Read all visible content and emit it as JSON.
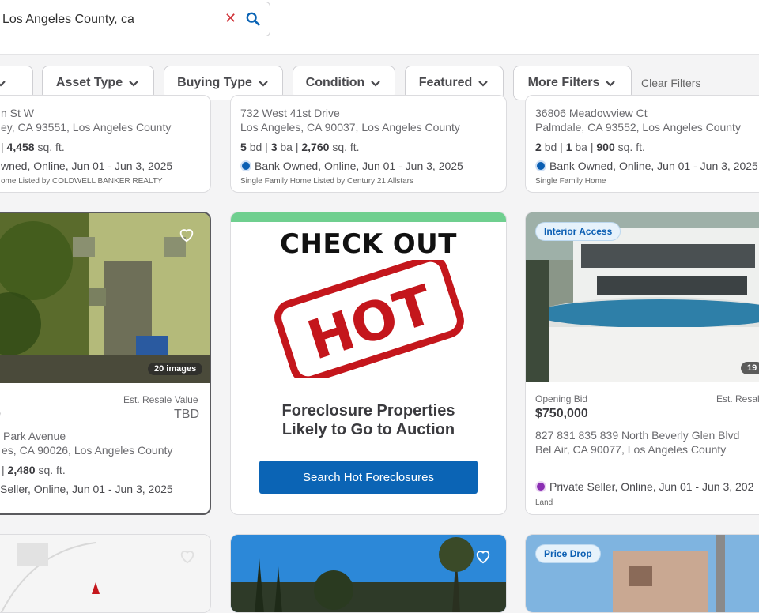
{
  "search": {
    "value": "Los Angeles County, ca"
  },
  "filters": [
    {
      "label": "Asset Type"
    },
    {
      "label": "Buying Type"
    },
    {
      "label": "Condition"
    },
    {
      "label": "Featured"
    },
    {
      "label": "More Filters"
    }
  ],
  "clear_filters": "Clear Filters",
  "top_row": [
    {
      "address1": "n St W",
      "address2": "ey, CA 93551, Los Angeles County",
      "sqft": "4,458",
      "sqft_unit": "sq. ft.",
      "status": "wned, Online, Jun 01 - Jun 3, 2025",
      "footnote": "ome Listed by COLDWELL BANKER REALTY"
    },
    {
      "address1": "732 West 41st Drive",
      "address2": "Los Angeles, CA 90037, Los Angeles County",
      "bd": "5",
      "ba": "3",
      "sqft": "2,760",
      "bd_unit": "bd",
      "ba_unit": "ba",
      "sqft_unit": "sq. ft.",
      "status": "Bank Owned, Online, Jun 01 - Jun 3, 2025",
      "footnote": "Single Family Home Listed by Century 21 Allstars"
    },
    {
      "address1": "36806 Meadowview Ct",
      "address2": "Palmdale, CA 93552, Los Angeles County",
      "bd": "2",
      "ba": "1",
      "sqft": "900",
      "bd_unit": "bd",
      "ba_unit": "ba",
      "sqft_unit": "sq. ft.",
      "status": "Bank Owned, Online, Jun 01 - Jun 3, 2025",
      "footnote": "Single Family Home"
    }
  ],
  "mid_left": {
    "image_count": "20 images",
    "resale_label": "Est. Resale Value",
    "resale_value": "TBD",
    "bid_value": "0",
    "address1": "Park Avenue",
    "address2": "es, CA 90026, Los Angeles County",
    "sqft": "2,480",
    "sqft_unit": "sq. ft.",
    "status": "Seller, Online, Jun 01 - Jun 3, 2025"
  },
  "promo": {
    "check_out": "CHECK OUT",
    "stamp": "HOT",
    "title_line1": "Foreclosure Properties",
    "title_line2": "Likely to Go to Auction",
    "button": "Search Hot Foreclosures"
  },
  "mid_right": {
    "badge": "Interior Access",
    "image_count": "19",
    "bid_label": "Opening Bid",
    "bid_value": "$750,000",
    "resale_label": "Est. Resal",
    "address1": "827 831 835 839 North Beverly Glen Blvd",
    "address2": "Bel Air, CA 90077, Los Angeles County",
    "status": "Private Seller, Online, Jun 01 - Jun 3, 202",
    "footnote": "Land"
  },
  "bottom_right": {
    "badge": "Price Drop"
  },
  "colors": {
    "accent": "#0b64b5",
    "promo_stripe": "#6fcf8f",
    "stamp_red": "#c4161c"
  }
}
